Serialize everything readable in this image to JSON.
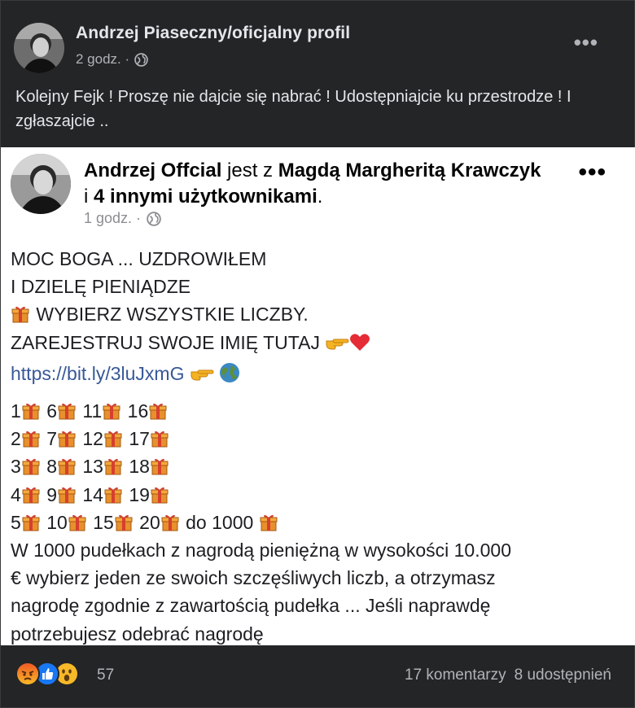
{
  "post": {
    "author": "Andrzej Piaseczny/oficjalny profil",
    "time": "2 godz. ·",
    "text": "Kolejny Fejk ! Proszę nie dajcie się nabrać ! Udostępniajcie ku przestrodze ! I zgłaszajcie .."
  },
  "shared": {
    "author": "Andrzej Offcial",
    "with_word": "jest z",
    "tagged": "Magdą Margheritą Krawczyk",
    "and_word": "i",
    "others": "4 innymi użytkownikami",
    "period": ".",
    "time": "1 godz. ·",
    "lines": {
      "l1": "MOC BOGA ... UZDROWIŁEM",
      "l2": "I DZIELĘ PIENIĄDZE",
      "l3": "WYBIERZ WSZYSTKIE LICZBY.",
      "l4": "ZAREJESTRUJ SWOJE IMIĘ TUTAJ",
      "link": "https://bit.ly/3luJxmG",
      "grid": [
        [
          "1",
          "6",
          "11",
          "16"
        ],
        [
          "2",
          "7",
          "12",
          "17"
        ],
        [
          "3",
          "8",
          "13",
          "18"
        ],
        [
          "4",
          "9",
          "14",
          "19"
        ],
        [
          "5",
          "10",
          "15",
          "20"
        ]
      ],
      "grid_tail": "do 1000",
      "p1": "W 1000 pudełkach z nagrodą pieniężną w wysokości 10.000",
      "p2": "€ wybierz jeden ze swoich szczęśliwych liczb, a otrzymasz",
      "p3": "nagrodę zgodnie z zawartością pudełka ... Jeśli naprawdę",
      "p4": "potrzebujesz odebrać nagrodę"
    }
  },
  "footer": {
    "reactions_count": "57",
    "comments": "17 komentarzy",
    "shares": "8 udostępnień"
  },
  "icons": [
    "globe-icon",
    "more-options-icon",
    "gift-icon",
    "pointing-hand-icon",
    "heart-icon",
    "earth-icon",
    "angry-reaction-icon",
    "like-reaction-icon",
    "wow-reaction-icon"
  ],
  "colors": {
    "background": "#242526",
    "text": "#e4e6eb",
    "muted": "#b0b3b8",
    "link": "#385898",
    "like": "#1877f2",
    "angry": "#e9710f",
    "wow": "#f7b928"
  }
}
